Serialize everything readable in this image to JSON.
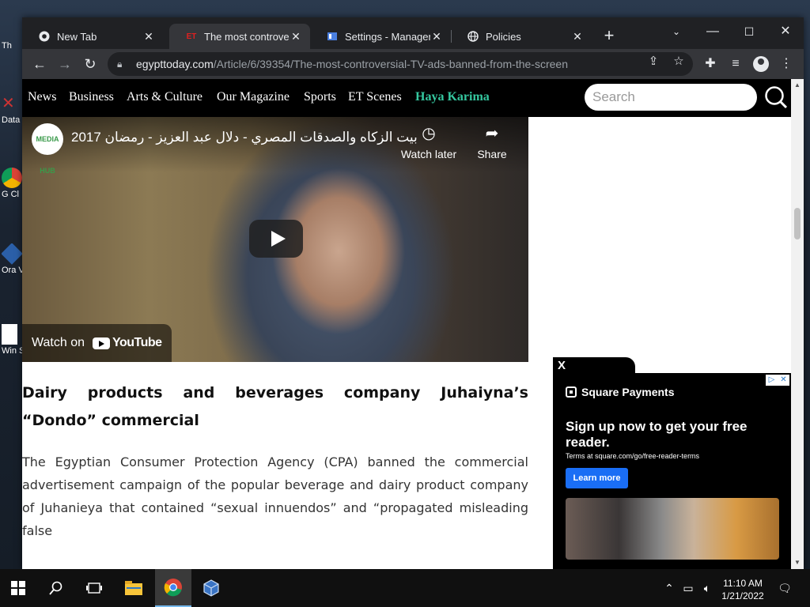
{
  "desktop": {
    "icons": [
      {
        "label": "Th"
      },
      {
        "label": "Data"
      },
      {
        "label": "G Cl"
      },
      {
        "label": "Ora Virt"
      },
      {
        "label": "Win Sec"
      }
    ]
  },
  "browser": {
    "tabs": [
      {
        "title": "New Tab",
        "favicon": "chrome-icon"
      },
      {
        "title": "The most controversial TV ads banned from the screen",
        "favicon": "egypttoday-icon",
        "favicon_text": "ET"
      },
      {
        "title": "Settings - Management",
        "favicon": "settings-page-icon"
      },
      {
        "title": "Policies",
        "favicon": "globe-icon"
      }
    ],
    "new_tab_label": "+",
    "url_domain": "egypttoday.com",
    "url_path": "/Article/6/39354/The-most-controversial-TV-ads-banned-from-the-screen"
  },
  "site": {
    "nav": [
      {
        "label": "News"
      },
      {
        "label": "Business"
      },
      {
        "label": "Arts & Culture"
      },
      {
        "label": "Our Magazine"
      },
      {
        "label": "Sports"
      },
      {
        "label": "ET Scenes"
      },
      {
        "label": "Haya Karima"
      }
    ],
    "search_placeholder": "Search"
  },
  "video": {
    "channel": "MEDIA HUB",
    "title": "بيت الزكاه والصدقات المصري - دلال عبد العزيز - رمضان 2017",
    "watch_later": "Watch later",
    "share": "Share",
    "watch_on": "Watch on",
    "youtube": "YouTube"
  },
  "article": {
    "heading": "Dairy products and beverages company Juhaiyna’s “Dondo” commercial",
    "paragraph": "The Egyptian Consumer Protection Agency (CPA) banned the commercial advertisement campaign of the popular beverage and dairy product company of Juhanieya that contained “sexual innuendos” and “propagated misleading false"
  },
  "ad": {
    "close": "X",
    "brand": "Square Payments",
    "headline": "Sign up now to get your free reader.",
    "terms": "Terms at square.com/go/free-reader-terms",
    "cta": "Learn more"
  },
  "taskbar": {
    "time": "11:10 AM",
    "date": "1/21/2022"
  },
  "colors": {
    "nav_accent": "#35c8a0",
    "cta_blue": "#1a6ef5"
  }
}
